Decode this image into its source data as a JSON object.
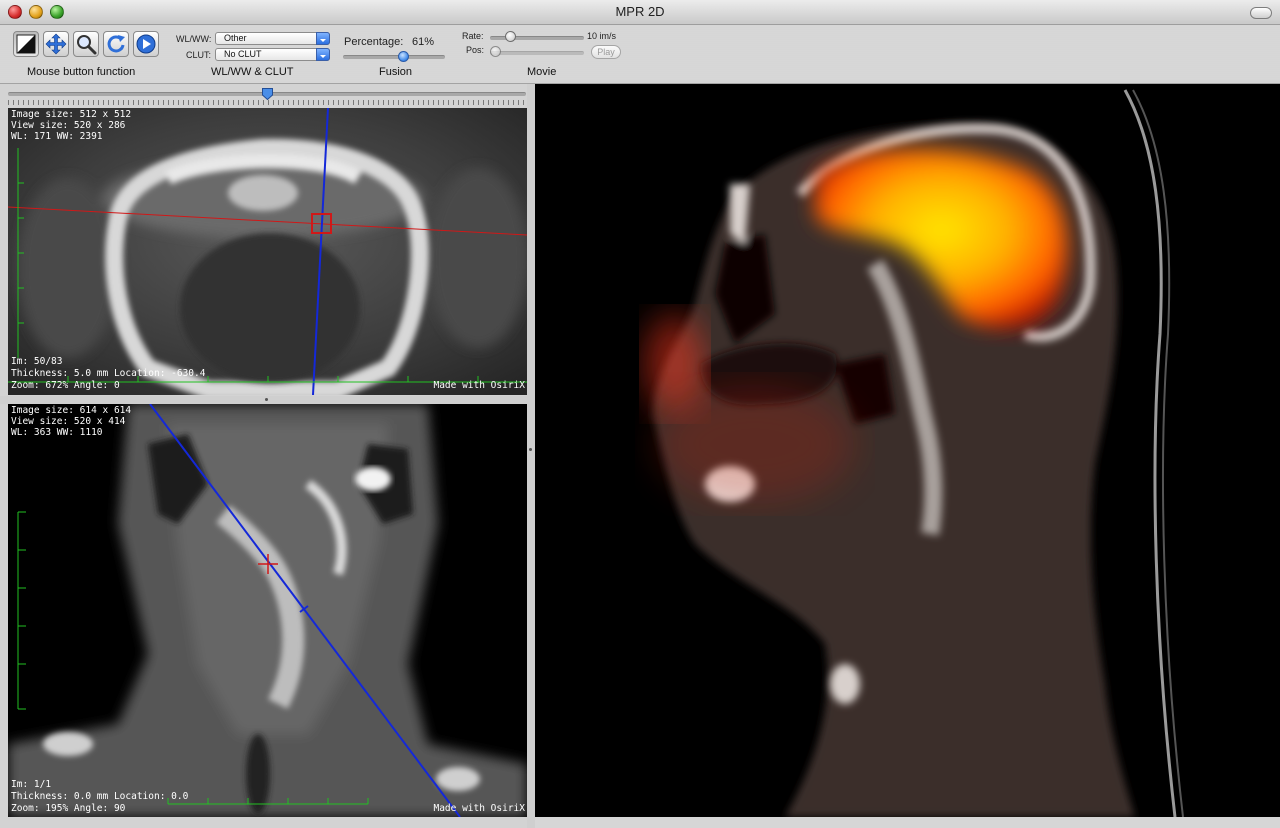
{
  "window": {
    "title": "MPR 2D"
  },
  "toolbar": {
    "mouse_group_label": "Mouse button function",
    "tools": [
      {
        "name": "wlww-tool",
        "icon": "contrast-icon",
        "active": true
      },
      {
        "name": "move-tool",
        "icon": "move-arrows-icon",
        "active": false
      },
      {
        "name": "zoom-tool",
        "icon": "magnifier-icon",
        "active": false
      },
      {
        "name": "rotate-tool",
        "icon": "rotate-icon",
        "active": false
      },
      {
        "name": "scroll-tool",
        "icon": "play-circle-icon",
        "active": false
      }
    ],
    "wlww_group": {
      "wlww_label": "WL/WW:",
      "wlww_value": "Other",
      "clut_label": "CLUT:",
      "clut_value": "No CLUT",
      "group_label": "WL/WW & CLUT"
    },
    "fusion_group": {
      "percentage_label": "Percentage:",
      "percentage_value": "61%",
      "percentage": 61,
      "group_label": "Fusion"
    },
    "movie_group": {
      "rate_label": "Rate:",
      "rate_value": "10 im/s",
      "pos_label": "Pos:",
      "play_label": "Play",
      "group_label": "Movie"
    }
  },
  "axial_view": {
    "image_size": "Image size: 512 x 512",
    "view_size": "View size: 520 x 286",
    "wl_ww": "WL: 171 WW: 2391",
    "im": "Im: 50/83",
    "thickness": "Thickness: 5.0 mm Location: -630.4",
    "zoom": "Zoom: 672% Angle: 0",
    "made_with": "Made with OsiriX"
  },
  "coronal_view": {
    "image_size": "Image size: 614 x 614",
    "view_size": "View size: 520 x 414",
    "wl_ww": "WL: 363 WW: 1110",
    "im": "Im: 1/1",
    "thickness": "Thickness: 0.0 mm Location: 0.0",
    "zoom": "Zoom: 195% Angle: 90",
    "made_with": "Made with OsiriX"
  },
  "colors": {
    "crosshair_red": "#d01818",
    "crosshair_blue": "#1428d8",
    "scale_green": "#22c022",
    "pet_hot": "#ffcc00"
  }
}
